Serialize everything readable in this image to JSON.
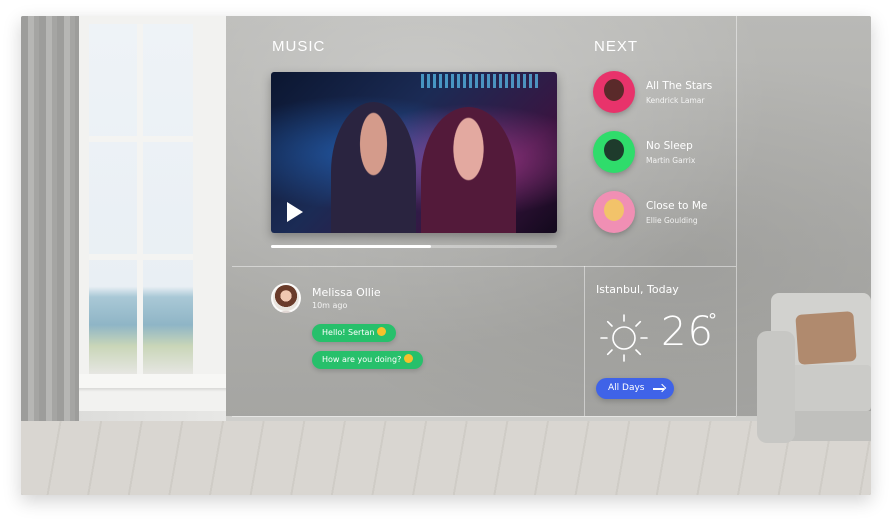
{
  "music": {
    "title": "MUSIC",
    "progress": 0.56
  },
  "next": {
    "title": "NEXT",
    "tracks": [
      {
        "title": "All The Stars",
        "artist": "Kendrick Lamar",
        "color": "#e8336b"
      },
      {
        "title": "No Sleep",
        "artist": "Martin Garrix",
        "color": "#2fdc6b"
      },
      {
        "title": "Close to Me",
        "artist": "Ellie Goulding",
        "color": "#f08fb4"
      }
    ]
  },
  "message": {
    "name": "Melissa Ollie",
    "time": "10m ago",
    "bubbles": [
      {
        "text": "Hello! Sertan"
      },
      {
        "text": "How are you doing?"
      }
    ]
  },
  "weather": {
    "location": "Istanbul, Today",
    "temperature": "26",
    "degree_symbol": "°",
    "button": "All Days"
  },
  "colors": {
    "accent_blue": "#3f63e8",
    "bubble_green": "#27c06b"
  }
}
